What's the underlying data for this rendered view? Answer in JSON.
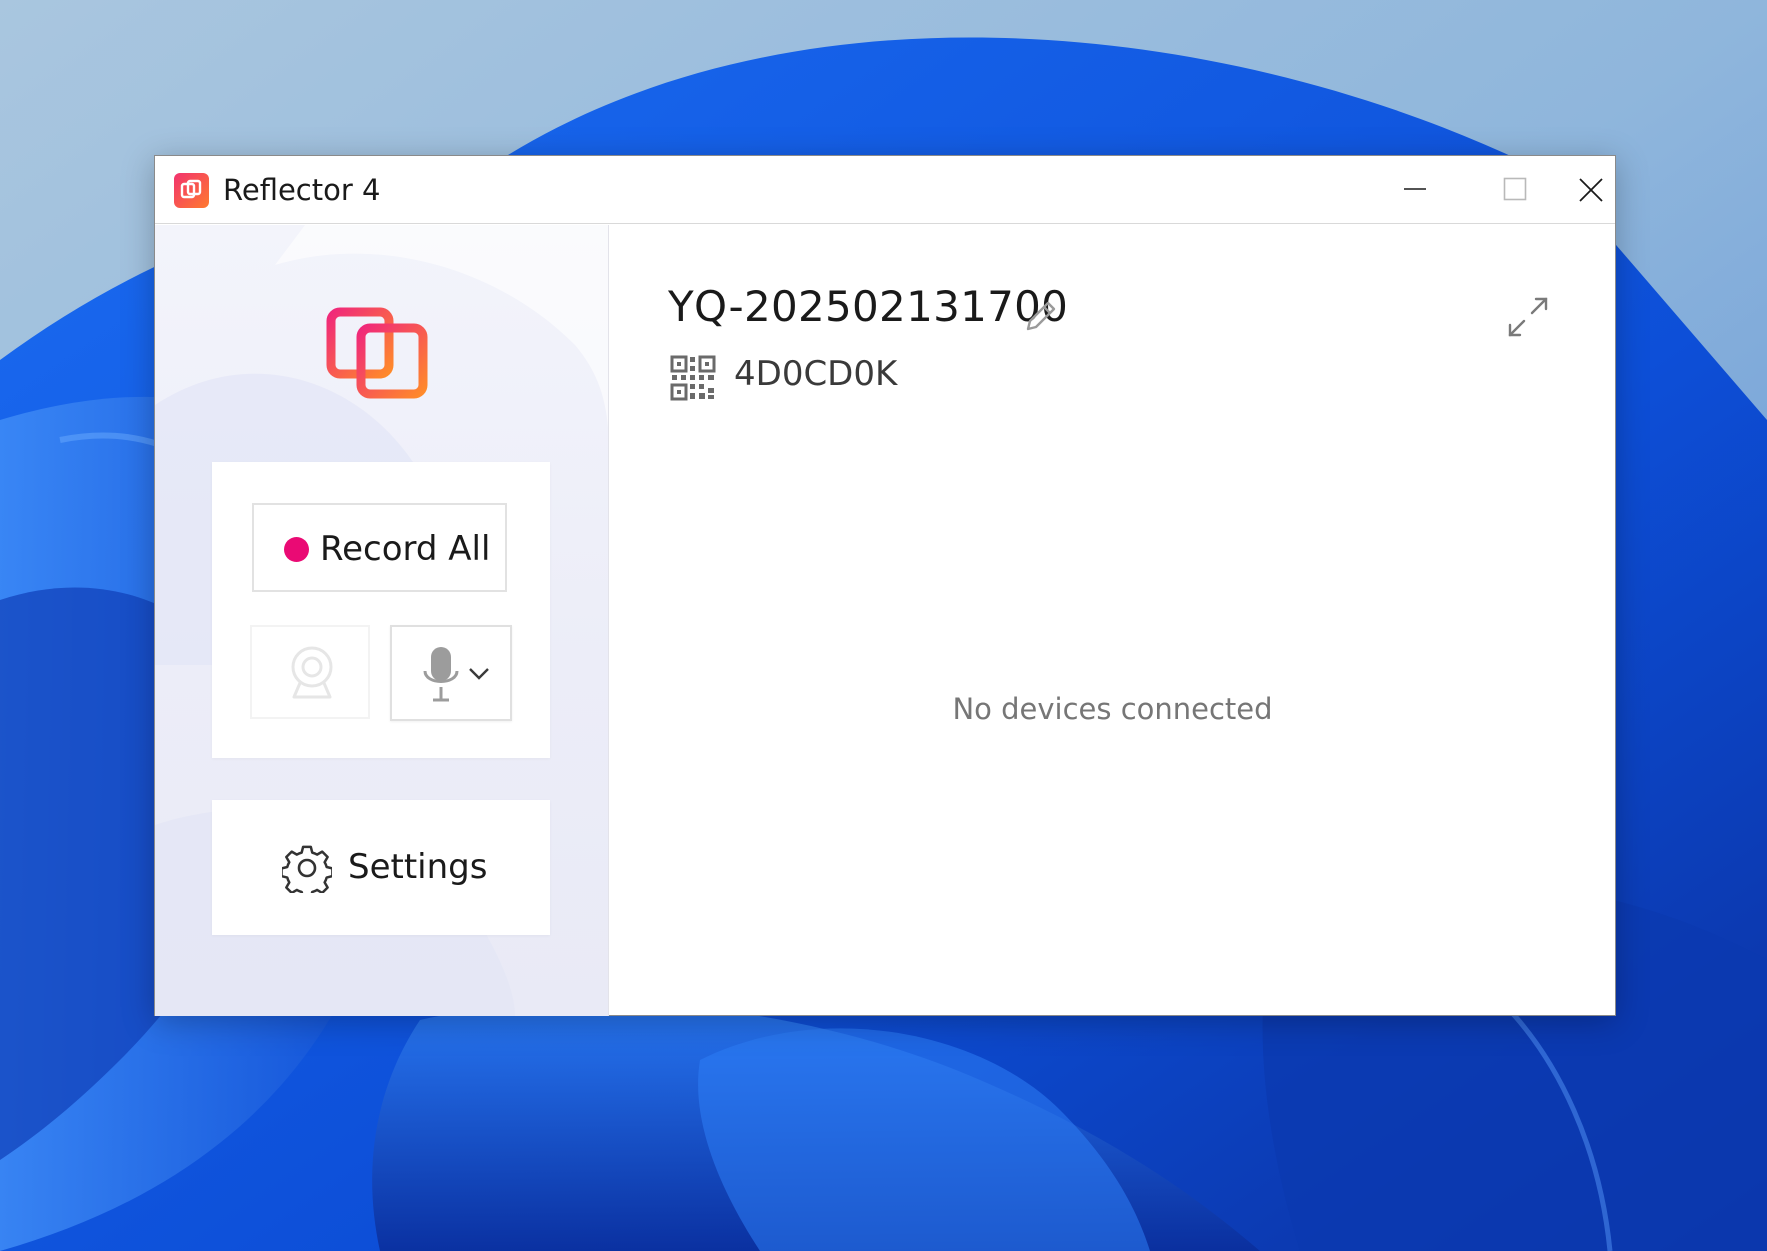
{
  "window": {
    "title": "Reflector 4",
    "controls": {
      "minimize": "minimize",
      "maximize": "maximize",
      "close": "close"
    }
  },
  "sidebar": {
    "record_all_label": "Record All",
    "settings_label": "Settings",
    "camera_enabled": false
  },
  "main": {
    "device_name": "YQ-202502131700",
    "connection_code": "4D0CD0K",
    "empty_message": "No devices connected"
  },
  "colors": {
    "accent_pink": "#ea0a74",
    "logo_gradient_start": "#f2336f",
    "logo_gradient_end": "#ff7a2e"
  },
  "icons": [
    "app-logo-icon",
    "minimize-icon",
    "maximize-icon",
    "close-icon",
    "record-dot-icon",
    "camera-icon",
    "microphone-icon",
    "chevron-down-icon",
    "gear-icon",
    "edit-pencil-icon",
    "qr-code-icon",
    "expand-icon"
  ]
}
